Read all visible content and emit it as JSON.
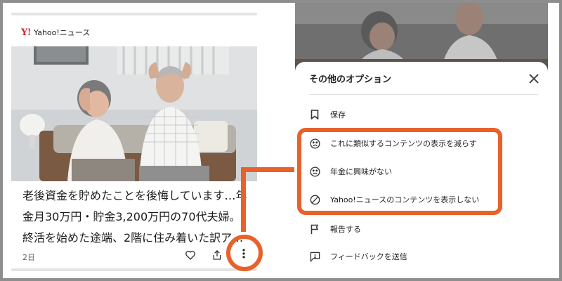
{
  "card": {
    "source": "Yahoo!ニュース",
    "headline_lines": [
      "老後資金を貯めたことを後悔しています…年",
      "金月30万円・貯金3,200万円の70代夫婦。",
      "終活を始めた途端、2階に住み着いた訳ア…"
    ],
    "time": "2日"
  },
  "sheet": {
    "title": "その他のオプション",
    "options": [
      {
        "label": "保存",
        "icon": "bookmark-icon"
      },
      {
        "label": "これに類似するコンテンツの表示を減らす",
        "icon": "sad-face-icon"
      },
      {
        "label": "年金に興味がない",
        "icon": "sad-face-icon"
      },
      {
        "label": "Yahoo!ニュースのコンテンツを表示しない",
        "icon": "block-icon"
      },
      {
        "label": "報告する",
        "icon": "flag-icon"
      },
      {
        "label": "フィードバックを送信",
        "icon": "feedback-icon"
      }
    ]
  },
  "colors": {
    "accent": "#e8612b",
    "yahoo_red": "#e0202d"
  }
}
